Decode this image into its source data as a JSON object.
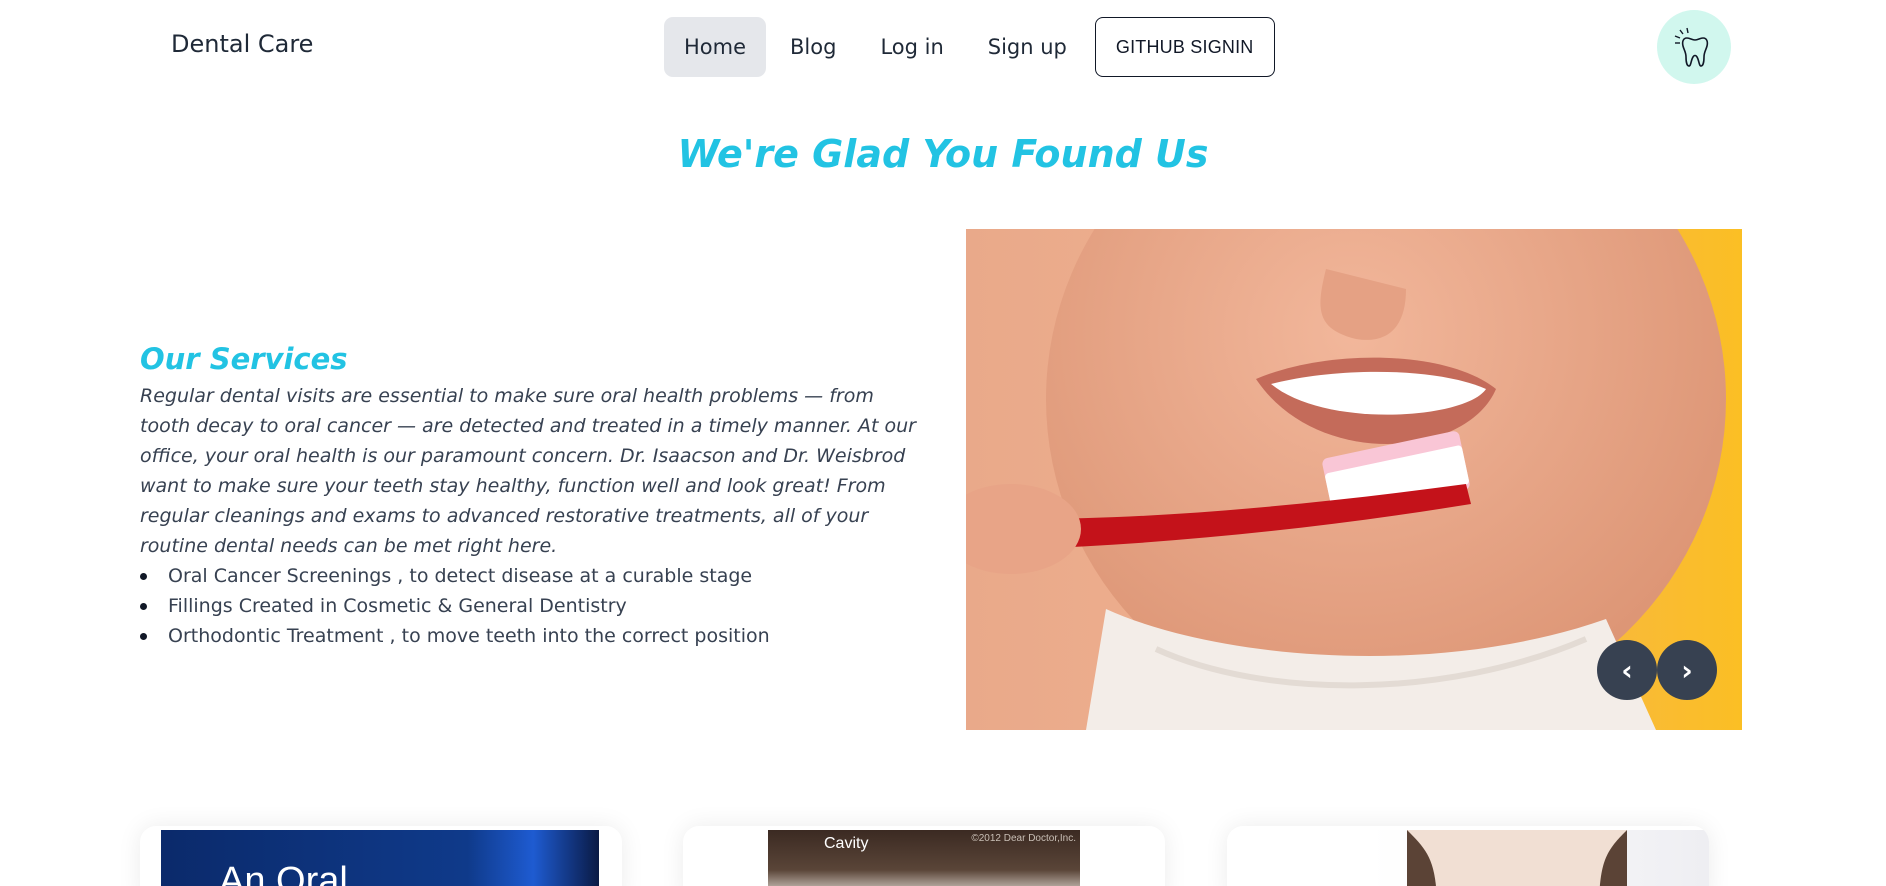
{
  "navbar": {
    "brand": "Dental Care",
    "links": [
      {
        "label": "Home",
        "active": true
      },
      {
        "label": "Blog",
        "active": false
      },
      {
        "label": "Log in",
        "active": false
      },
      {
        "label": "Sign up",
        "active": false
      }
    ],
    "github_button": "GITHUB SIGNIN",
    "avatar_icon": "tooth-icon"
  },
  "hero": {
    "title": "We're Glad You Found Us"
  },
  "services": {
    "title": "Our Services",
    "description": "Regular dental visits are essential to make sure oral health problems — from tooth decay to oral cancer — are detected and treated in a timely manner. At our office, your oral health is our paramount concern. Dr. Isaacson and Dr. Weisbrod want to make sure your teeth stay healthy, function well and look great! From regular cleanings and exams to advanced restorative treatments, all of your routine dental needs can be met right here.",
    "items": [
      "Oral Cancer Screenings , to detect disease at a curable stage",
      "Fillings Created in Cosmetic & General Dentistry",
      "Orthodontic Treatment , to move teeth into the correct position"
    ]
  },
  "carousel": {
    "prev_label": "‹",
    "next_label": "›"
  },
  "cards": [
    {
      "image_text": "An Oral"
    },
    {
      "image_label": "Cavity",
      "image_copyright": "©2012 Dear Doctor,Inc."
    },
    {}
  ],
  "colors": {
    "accent": "#22c3e3",
    "avatar_bg": "#d1f7ee",
    "carousel_button": "#374151"
  }
}
